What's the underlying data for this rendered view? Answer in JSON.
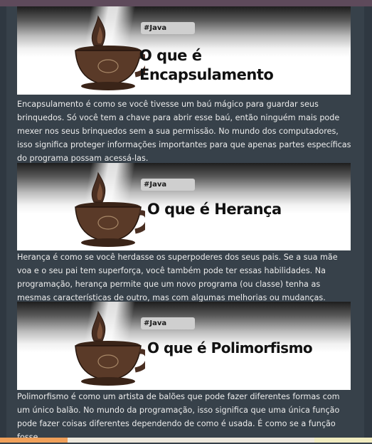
{
  "posts": [
    {
      "tag": "#Java",
      "title_line1": "O que é",
      "title_line2": "Encapsulamento",
      "text": "Encapsulamento é como se você tivesse um baú mágico para guardar seus brinquedos. Só você tem a chave para abrir esse baú, então ninguém mais pode mexer nos seus brinquedos sem a sua permissão. No mundo dos computadores, isso significa proteger informações importantes para que apenas partes específicas do programa possam acessá-las."
    },
    {
      "tag": "#Java",
      "title": "O que é Herança",
      "text": "Herança é como se você herdasse os superpoderes dos seus pais. Se a sua mãe voa e o seu pai tem superforça, você também pode ter essas habilidades. Na programação, herança permite que um novo programa (ou classe) tenha as mesmas características de outro, mas com algumas melhorias ou mudanças."
    },
    {
      "tag": "#Java",
      "title": "O que é Polimorfismo",
      "text": "Polimorfismo é como um artista de balões que pode fazer diferentes formas com um único balão. No mundo da programação, isso significa que uma única função pode fazer coisas diferentes dependendo de como é usada. É como se a função fosse"
    }
  ]
}
